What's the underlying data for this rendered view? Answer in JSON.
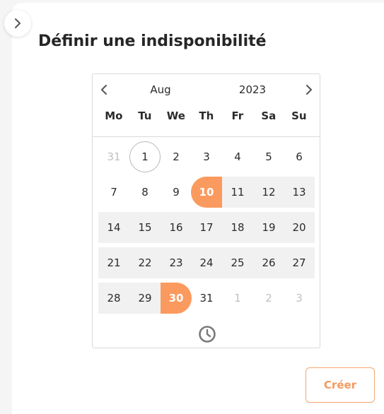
{
  "page": {
    "title": "Définir une indisponibilité"
  },
  "calendar": {
    "month": "Aug",
    "year": "2023",
    "weekdays": [
      "Mo",
      "Tu",
      "We",
      "Th",
      "Fr",
      "Sa",
      "Su"
    ],
    "days": [
      [
        "31",
        "1",
        "2",
        "3",
        "4",
        "5",
        "6"
      ],
      [
        "7",
        "8",
        "9",
        "10",
        "11",
        "12",
        "13"
      ],
      [
        "14",
        "15",
        "16",
        "17",
        "18",
        "19",
        "20"
      ],
      [
        "21",
        "22",
        "23",
        "24",
        "25",
        "26",
        "27"
      ],
      [
        "28",
        "29",
        "30",
        "31",
        "1",
        "2",
        "3"
      ]
    ],
    "today": "1",
    "selected_range": {
      "start": "10",
      "end": "30"
    }
  },
  "actions": {
    "create_label": "Créer"
  },
  "icons": {
    "collapse": "chevron-right-icon",
    "prev_month": "chevron-left-icon",
    "next_month": "chevron-right-icon",
    "time": "clock-icon"
  },
  "colors": {
    "accent": "#fb9a5e",
    "accent_text": "#f39a5f",
    "range_fill": "#f1f1f1",
    "muted_day": "#c0c0c6"
  }
}
